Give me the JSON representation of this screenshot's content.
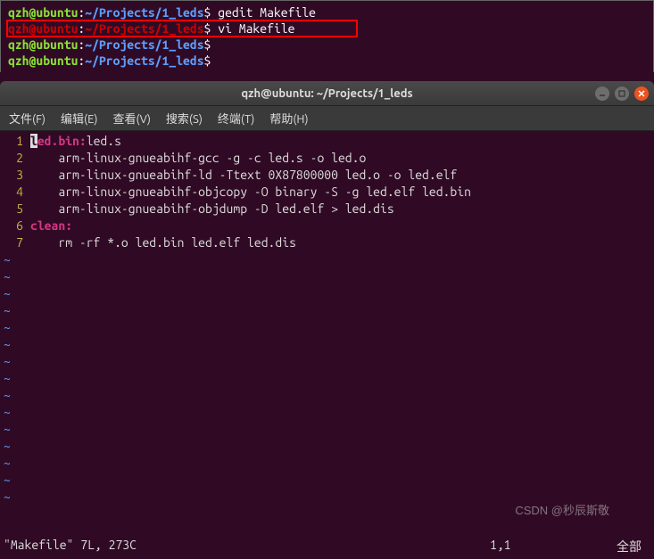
{
  "top_terminal": {
    "user": "qzh",
    "host": "ubuntu",
    "path": "~/Projects/1_leds",
    "lines": [
      {
        "cmd": "gedit Makefile",
        "highlight": false
      },
      {
        "cmd": "vi Makefile",
        "highlight": true
      },
      {
        "cmd": "",
        "highlight": false
      },
      {
        "cmd": "",
        "highlight": false
      }
    ]
  },
  "window": {
    "title": "qzh@ubuntu: ~/Projects/1_leds",
    "menu": {
      "file": "文件(F)",
      "edit": "编辑(E)",
      "view": "查看(V)",
      "search": "搜索(S)",
      "terminal": "终端(T)",
      "help": "帮助(H)"
    }
  },
  "editor": {
    "lines": [
      {
        "n": "1",
        "target": "led.bin:",
        "rest": "led.s",
        "cursor_first": true
      },
      {
        "n": "2",
        "target": "",
        "rest": "    arm-linux-gnueabihf-gcc -g -c led.s -o led.o"
      },
      {
        "n": "3",
        "target": "",
        "rest": "    arm-linux-gnueabihf-ld -Ttext 0X87800000 led.o -o led.elf"
      },
      {
        "n": "4",
        "target": "",
        "rest": "    arm-linux-gnueabihf-objcopy -O binary -S -g led.elf led.bin"
      },
      {
        "n": "5",
        "target": "",
        "rest": "    arm-linux-gnueabihf-objdump -D led.elf > led.dis"
      },
      {
        "n": "6",
        "target": "clean:",
        "rest": ""
      },
      {
        "n": "7",
        "target": "",
        "rest": "    rm -rf *.o led.bin led.elf led.dis"
      }
    ],
    "status": {
      "left": "\"Makefile\" 7L, 273C",
      "mid": "1,1",
      "right": "全部"
    }
  },
  "watermark": "CSDN @秒辰斯敬"
}
